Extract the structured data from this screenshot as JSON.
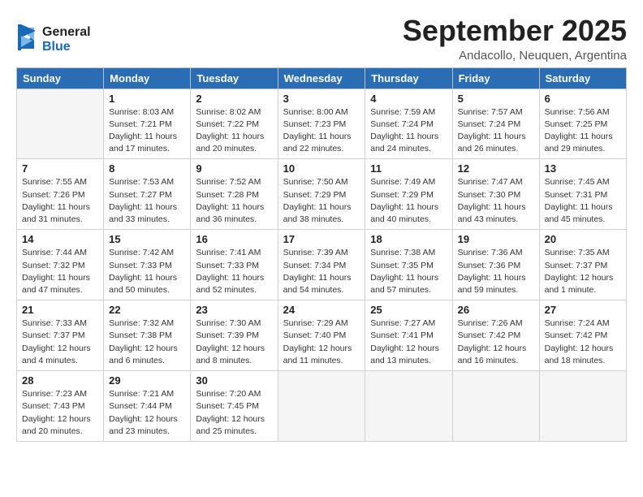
{
  "logo": {
    "line1": "General",
    "line2": "Blue"
  },
  "header": {
    "month": "September 2025",
    "location": "Andacollo, Neuquen, Argentina"
  },
  "weekdays": [
    "Sunday",
    "Monday",
    "Tuesday",
    "Wednesday",
    "Thursday",
    "Friday",
    "Saturday"
  ],
  "weeks": [
    [
      {
        "day": "",
        "info": ""
      },
      {
        "day": "1",
        "info": "Sunrise: 8:03 AM\nSunset: 7:21 PM\nDaylight: 11 hours\nand 17 minutes."
      },
      {
        "day": "2",
        "info": "Sunrise: 8:02 AM\nSunset: 7:22 PM\nDaylight: 11 hours\nand 20 minutes."
      },
      {
        "day": "3",
        "info": "Sunrise: 8:00 AM\nSunset: 7:23 PM\nDaylight: 11 hours\nand 22 minutes."
      },
      {
        "day": "4",
        "info": "Sunrise: 7:59 AM\nSunset: 7:24 PM\nDaylight: 11 hours\nand 24 minutes."
      },
      {
        "day": "5",
        "info": "Sunrise: 7:57 AM\nSunset: 7:24 PM\nDaylight: 11 hours\nand 26 minutes."
      },
      {
        "day": "6",
        "info": "Sunrise: 7:56 AM\nSunset: 7:25 PM\nDaylight: 11 hours\nand 29 minutes."
      }
    ],
    [
      {
        "day": "7",
        "info": "Sunrise: 7:55 AM\nSunset: 7:26 PM\nDaylight: 11 hours\nand 31 minutes."
      },
      {
        "day": "8",
        "info": "Sunrise: 7:53 AM\nSunset: 7:27 PM\nDaylight: 11 hours\nand 33 minutes."
      },
      {
        "day": "9",
        "info": "Sunrise: 7:52 AM\nSunset: 7:28 PM\nDaylight: 11 hours\nand 36 minutes."
      },
      {
        "day": "10",
        "info": "Sunrise: 7:50 AM\nSunset: 7:29 PM\nDaylight: 11 hours\nand 38 minutes."
      },
      {
        "day": "11",
        "info": "Sunrise: 7:49 AM\nSunset: 7:29 PM\nDaylight: 11 hours\nand 40 minutes."
      },
      {
        "day": "12",
        "info": "Sunrise: 7:47 AM\nSunset: 7:30 PM\nDaylight: 11 hours\nand 43 minutes."
      },
      {
        "day": "13",
        "info": "Sunrise: 7:45 AM\nSunset: 7:31 PM\nDaylight: 11 hours\nand 45 minutes."
      }
    ],
    [
      {
        "day": "14",
        "info": "Sunrise: 7:44 AM\nSunset: 7:32 PM\nDaylight: 11 hours\nand 47 minutes."
      },
      {
        "day": "15",
        "info": "Sunrise: 7:42 AM\nSunset: 7:33 PM\nDaylight: 11 hours\nand 50 minutes."
      },
      {
        "day": "16",
        "info": "Sunrise: 7:41 AM\nSunset: 7:33 PM\nDaylight: 11 hours\nand 52 minutes."
      },
      {
        "day": "17",
        "info": "Sunrise: 7:39 AM\nSunset: 7:34 PM\nDaylight: 11 hours\nand 54 minutes."
      },
      {
        "day": "18",
        "info": "Sunrise: 7:38 AM\nSunset: 7:35 PM\nDaylight: 11 hours\nand 57 minutes."
      },
      {
        "day": "19",
        "info": "Sunrise: 7:36 AM\nSunset: 7:36 PM\nDaylight: 11 hours\nand 59 minutes."
      },
      {
        "day": "20",
        "info": "Sunrise: 7:35 AM\nSunset: 7:37 PM\nDaylight: 12 hours\nand 1 minute."
      }
    ],
    [
      {
        "day": "21",
        "info": "Sunrise: 7:33 AM\nSunset: 7:37 PM\nDaylight: 12 hours\nand 4 minutes."
      },
      {
        "day": "22",
        "info": "Sunrise: 7:32 AM\nSunset: 7:38 PM\nDaylight: 12 hours\nand 6 minutes."
      },
      {
        "day": "23",
        "info": "Sunrise: 7:30 AM\nSunset: 7:39 PM\nDaylight: 12 hours\nand 8 minutes."
      },
      {
        "day": "24",
        "info": "Sunrise: 7:29 AM\nSunset: 7:40 PM\nDaylight: 12 hours\nand 11 minutes."
      },
      {
        "day": "25",
        "info": "Sunrise: 7:27 AM\nSunset: 7:41 PM\nDaylight: 12 hours\nand 13 minutes."
      },
      {
        "day": "26",
        "info": "Sunrise: 7:26 AM\nSunset: 7:42 PM\nDaylight: 12 hours\nand 16 minutes."
      },
      {
        "day": "27",
        "info": "Sunrise: 7:24 AM\nSunset: 7:42 PM\nDaylight: 12 hours\nand 18 minutes."
      }
    ],
    [
      {
        "day": "28",
        "info": "Sunrise: 7:23 AM\nSunset: 7:43 PM\nDaylight: 12 hours\nand 20 minutes."
      },
      {
        "day": "29",
        "info": "Sunrise: 7:21 AM\nSunset: 7:44 PM\nDaylight: 12 hours\nand 23 minutes."
      },
      {
        "day": "30",
        "info": "Sunrise: 7:20 AM\nSunset: 7:45 PM\nDaylight: 12 hours\nand 25 minutes."
      },
      {
        "day": "",
        "info": ""
      },
      {
        "day": "",
        "info": ""
      },
      {
        "day": "",
        "info": ""
      },
      {
        "day": "",
        "info": ""
      }
    ]
  ]
}
